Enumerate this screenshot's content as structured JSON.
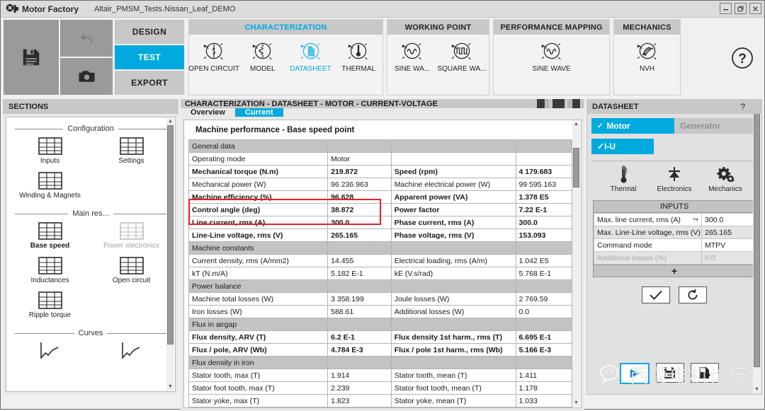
{
  "titlebar": {
    "app_name": "Motor Factory",
    "document": "Altair_PMSM_Tests.Nissan_Leaf_DEMO",
    "logo_icon": "motor-logo-icon",
    "minimize": "─",
    "restore": "❐",
    "close": "✕"
  },
  "quickaccess": {
    "save_icon": "save-floppy-icon",
    "undo_icon": "undo-arrow-icon",
    "camera_icon": "camera-icon"
  },
  "nav": [
    {
      "label": "DESIGN",
      "active": false
    },
    {
      "label": "TEST",
      "active": true
    },
    {
      "label": "EXPORT",
      "active": false
    }
  ],
  "ribbon_groups": [
    {
      "title": "CHARACTERIZATION",
      "accent": "#00a8e0",
      "items": [
        {
          "label": "OPEN CIRCUIT",
          "icon": "open-circuit-icon",
          "active": false
        },
        {
          "label": "MODEL",
          "icon": "model-icon",
          "active": false
        },
        {
          "label": "DATASHEET",
          "icon": "datasheet-icon",
          "active": true
        },
        {
          "label": "THERMAL",
          "icon": "thermal-icon",
          "active": false
        }
      ]
    },
    {
      "title": "WORKING POINT",
      "items": [
        {
          "label": "SINE WA...",
          "icon": "sine-wave-icon",
          "active": false
        },
        {
          "label": "SQUARE WA...",
          "icon": "square-wave-icon",
          "active": false
        }
      ]
    },
    {
      "title": "PERFORMANCE MAPPING",
      "items": [
        {
          "label": "SINE WAVE",
          "icon": "sine-wave-icon",
          "active": false
        }
      ]
    },
    {
      "title": "MECHANICS",
      "items": [
        {
          "label": "NVH",
          "icon": "nvh-icon",
          "active": false
        }
      ]
    }
  ],
  "help_icon": "help-question-icon",
  "sections": {
    "header": "SECTIONS",
    "groups": [
      {
        "legend": "Configuration",
        "items": [
          {
            "label": "Inputs",
            "icon": "table-icon",
            "bold": false,
            "disabled": false
          },
          {
            "label": "Settings",
            "icon": "table-icon",
            "bold": false,
            "disabled": false
          },
          {
            "label": "Winding & Magnets",
            "icon": "table-icon",
            "bold": false,
            "disabled": false
          }
        ]
      },
      {
        "legend": "Main res...",
        "items": [
          {
            "label": "Base speed",
            "icon": "table-icon",
            "bold": true,
            "disabled": false
          },
          {
            "label": "Power electronics",
            "icon": "table-icon",
            "bold": false,
            "disabled": true
          },
          {
            "label": "Inductances",
            "icon": "table-icon",
            "bold": false,
            "disabled": false
          },
          {
            "label": "Open circuit",
            "icon": "table-icon",
            "bold": false,
            "disabled": false
          },
          {
            "label": "Ripple torque",
            "icon": "table-icon",
            "bold": false,
            "disabled": false
          }
        ]
      },
      {
        "legend": "Curves",
        "items": [
          {
            "label": "",
            "icon": "curve-icon",
            "bold": false,
            "disabled": false
          },
          {
            "label": "",
            "icon": "curve-icon",
            "bold": false,
            "disabled": false
          }
        ]
      }
    ]
  },
  "content": {
    "header": "CHARACTERIZATION - DATASHEET - MOTOR - CURRENT-VOLTAGE",
    "view_icons": [
      "layout-split-left-icon",
      "layout-full-icon",
      "layout-split-right-icon"
    ],
    "tabs": [
      {
        "label": "Overview",
        "active": false
      },
      {
        "label": "Current",
        "active": true
      }
    ],
    "sheet_title": "Machine performance - Base speed point",
    "rows": [
      {
        "type": "group",
        "c1": "General data",
        "c2": "",
        "c3": "",
        "c4": ""
      },
      {
        "type": "data",
        "bold": false,
        "c1": "Operating mode",
        "c2": "Motor",
        "c3": "",
        "c4": ""
      },
      {
        "type": "data",
        "bold": true,
        "c1": "Mechanical torque (N.m)",
        "c2": "219.872",
        "c3": "Speed (rpm)",
        "c4": "4 179.683"
      },
      {
        "type": "data",
        "bold": false,
        "c1": "Mechanical power (W)",
        "c2": "96 236.963",
        "c3": "Machine electrical power (W)",
        "c4": "99 595.163"
      },
      {
        "type": "data",
        "bold": true,
        "c1": "Machine efficiency (%)",
        "c2": "96.628",
        "c3": "Apparent power (VA)",
        "c4": "1.378 E5"
      },
      {
        "type": "data",
        "bold": true,
        "c1": "Control angle (deg)",
        "c2": "38.872",
        "c3": "Power factor",
        "c4": "7.22 E-1"
      },
      {
        "type": "data",
        "bold": true,
        "c1": "Line current, rms (A)",
        "c2": "300.0",
        "c3": "Phase current, rms (A)",
        "c4": "300.0"
      },
      {
        "type": "data",
        "bold": true,
        "c1": "Line-Line voltage, rms (V)",
        "c2": "265.165",
        "c3": "Phase voltage, rms (V)",
        "c4": "153.093"
      },
      {
        "type": "group",
        "c1": "Machine constants",
        "c2": "",
        "c3": "",
        "c4": ""
      },
      {
        "type": "data",
        "bold": false,
        "c1": "Current density, rms (A/mm2)",
        "c2": "14.455",
        "c3": "Electrical loading, rms (A/m)",
        "c4": "1.042 E5"
      },
      {
        "type": "data",
        "bold": false,
        "c1": "kT (N.m/A)",
        "c2": "5.182 E-1",
        "c3": "kE (V.s/rad)",
        "c4": "5.768 E-1"
      },
      {
        "type": "group",
        "c1": "Power balance",
        "c2": "",
        "c3": "",
        "c4": ""
      },
      {
        "type": "data",
        "bold": false,
        "c1": "Machine total losses (W)",
        "c2": "3 358.199",
        "c3": "Joule losses (W)",
        "c4": "2 769.59"
      },
      {
        "type": "data",
        "bold": false,
        "c1": "Iron losses (W)",
        "c2": "588.61",
        "c3": "Additional losses (W)",
        "c4": "0.0"
      },
      {
        "type": "group",
        "c1": "Flux in airgap",
        "c2": "",
        "c3": "",
        "c4": ""
      },
      {
        "type": "data",
        "bold": true,
        "c1": "Flux density, ARV (T)",
        "c2": "6.2 E-1",
        "c3": "Flux density 1st harm., rms (T)",
        "c4": "6.695 E-1"
      },
      {
        "type": "data",
        "bold": true,
        "c1": "Flux / pole, ARV (Wb)",
        "c2": "4.784 E-3",
        "c3": "Flux / pole 1st harm., rms (Wb)",
        "c4": "5.166 E-3"
      },
      {
        "type": "group",
        "c1": "Flux density in iron",
        "c2": "",
        "c3": "",
        "c4": ""
      },
      {
        "type": "data",
        "bold": false,
        "c1": "Stator tooth, max (T)",
        "c2": "1.914",
        "c3": "Stator tooth, mean (T)",
        "c4": "1.411"
      },
      {
        "type": "data",
        "bold": false,
        "c1": "Stator foot tooth, max (T)",
        "c2": "2.239",
        "c3": "Stator foot tooth, mean (T)",
        "c4": "1.178"
      },
      {
        "type": "data",
        "bold": false,
        "c1": "Stator yoke, max (T)",
        "c2": "1.823",
        "c3": "Stator yoke, mean (T)",
        "c4": "1.033"
      }
    ],
    "highlight_color": "#ee1c24"
  },
  "datasheet": {
    "header": "DATASHEET",
    "help": "?",
    "mode_toggles": [
      {
        "label": "Motor",
        "selected": true
      },
      {
        "label": "Generator",
        "selected": false
      }
    ],
    "sub_toggle": {
      "label": "I-U",
      "selected": true
    },
    "physics": [
      {
        "label": "Thermal",
        "icon": "thermometer-icon"
      },
      {
        "label": "Electronics",
        "icon": "diode-icon"
      },
      {
        "label": "Mechanics",
        "icon": "gears-icon"
      }
    ],
    "inputs_title": "INPUTS",
    "inputs": [
      {
        "key": "Max. line current, rms (A)",
        "value": "300.0",
        "link_icon": "link-icon",
        "disabled": false
      },
      {
        "key": "Max. Line-Line voltage, rms (V)",
        "value": "265.165",
        "link_icon": "",
        "disabled": false
      },
      {
        "key": "Command mode",
        "value": "MTPV",
        "link_icon": "",
        "disabled": false
      },
      {
        "key": "Additional losses (%)",
        "value": "0.0",
        "link_icon": "",
        "disabled": true
      }
    ],
    "add_row_label": "+",
    "action_buttons": [
      {
        "icon": "check-icon",
        "name": "validate-button"
      },
      {
        "icon": "reset-icon",
        "name": "reset-button"
      }
    ],
    "run_buttons": [
      {
        "icon": "play-icon",
        "name": "solve-button",
        "selected": true
      },
      {
        "icon": "save-report-icon",
        "name": "export-report-button",
        "selected": false
      },
      {
        "icon": "export-file-icon",
        "name": "export-data-button",
        "selected": false
      }
    ]
  },
  "watermark": {
    "logo_icon": "wechat-icon",
    "text": "西莫电机论坛"
  }
}
